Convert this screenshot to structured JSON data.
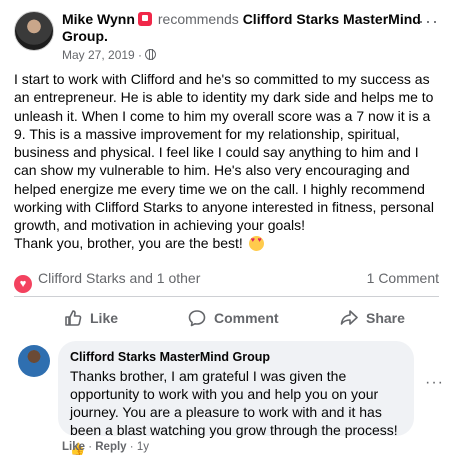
{
  "post": {
    "author": "Mike Wynn",
    "recommends_word": "recommends",
    "page_name": "Clifford Starks MasterMind Group.",
    "date": "May 27, 2019 ·",
    "body": "I start to work with Clifford and he's so committed to my success as an entrepreneur. He is able to identity my dark side and helps me to unleash it. When I come to him my overall score was a 7 now it is a 9. This is a massive improvement for my relationship, spiritual, business and physical. I feel like I could say anything to him and I can show my vulnerable to him. He's also very encouraging and helped energize me every time we on the call. I highly recommend working with Clifford Starks to anyone interested in fitness, personal growth, and motivation in achieving your goals!",
    "thanks": "Thank you, brother, you are the best!",
    "reactions_text": "Clifford Starks and 1 other",
    "comment_count": "1 Comment"
  },
  "actions": {
    "like": "Like",
    "comment": "Comment",
    "share": "Share"
  },
  "comment": {
    "author": "Clifford Starks MasterMind Group",
    "text": "Thanks brother, I am grateful I was given the opportunity to work with you and help you on your journey. You are a pleasure to work with and it has been a blast watching you grow through the process!",
    "like": "Like",
    "reply": "Reply",
    "age": "1y"
  },
  "colors": {
    "accent_red": "#f02849",
    "love": "#f3425f",
    "secondary_text": "#65676b",
    "bubble": "#f0f2f5"
  },
  "icons": [
    "recommend-icon",
    "globe-icon",
    "more-icon",
    "love-reaction-icon",
    "like-icon",
    "comment-icon",
    "share-icon",
    "heart-eyes-emoji",
    "thumbs-up-emoji"
  ]
}
